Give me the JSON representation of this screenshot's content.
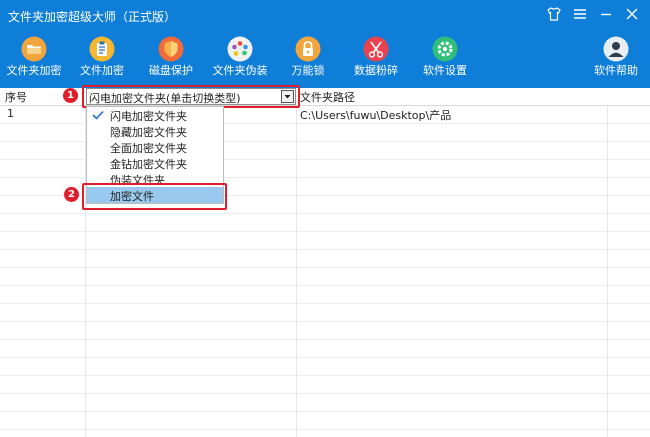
{
  "window": {
    "title": "文件夹加密超级大师（正式版）",
    "controls": [
      "shirt-icon",
      "menu-icon",
      "minimize-icon",
      "close-icon"
    ]
  },
  "toolbar": {
    "items": [
      {
        "label": "文件夹加密",
        "icon": "folder-icon"
      },
      {
        "label": "文件加密",
        "icon": "clipboard-icon"
      },
      {
        "label": "磁盘保护",
        "icon": "shield-icon"
      },
      {
        "label": "文件夹伪装",
        "icon": "palette-icon"
      },
      {
        "label": "万能锁",
        "icon": "lock-icon"
      },
      {
        "label": "数据粉碎",
        "icon": "scissors-icon"
      },
      {
        "label": "软件设置",
        "icon": "gear-icon"
      },
      {
        "label": "软件帮助",
        "icon": "user-icon"
      }
    ]
  },
  "table": {
    "headers": {
      "index": "序号",
      "path": "文件夹路径"
    },
    "rows": [
      {
        "index": "1",
        "path": "C:\\Users\\fuwu\\Desktop\\产品"
      }
    ]
  },
  "encrypt_type": {
    "selected": "闪电加密文件夹(单击切换类型)",
    "options": [
      "闪电加密文件夹",
      "隐藏加密文件夹",
      "全面加密文件夹",
      "金钻加密文件夹",
      "伪装文件夹",
      "加密文件"
    ],
    "checked_index": 0,
    "highlighted_index": 5
  },
  "annotations": [
    "1",
    "2"
  ],
  "colors": {
    "header_bg": "#0f7ed8",
    "highlight_annotation": "#e01e2b",
    "selection_bg": "#99c9ef"
  }
}
